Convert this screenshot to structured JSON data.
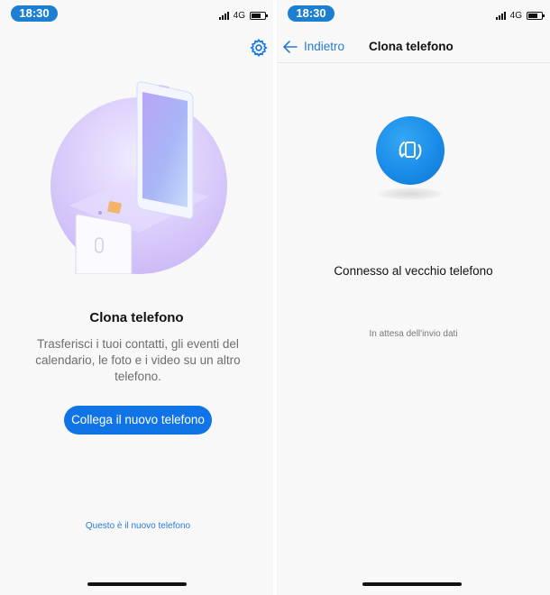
{
  "status_bar": {
    "time": "18:30",
    "network": "4G"
  },
  "left_screen": {
    "title": "Clona telefono",
    "description": "Trasferisci i tuoi contatti, gli eventi del calendario, le foto e i video su un altro telefono.",
    "primary_button": "Collega il nuovo telefono",
    "secondary_link": "Questo è il nuovo telefono",
    "settings_icon": "gear-icon",
    "illustration": "phone-clone-illustration"
  },
  "right_screen": {
    "back_label": "Indietro",
    "title": "Clona telefono",
    "status": "Connesso al vecchio telefono",
    "substatus": "In attesa dell'invio dati",
    "center_icon": "phone-clone-icon"
  },
  "colors": {
    "accent": "#1174e6",
    "status_pill": "#1d7fd1",
    "link": "#2a7bd6",
    "illustration": "#c4aef3"
  }
}
